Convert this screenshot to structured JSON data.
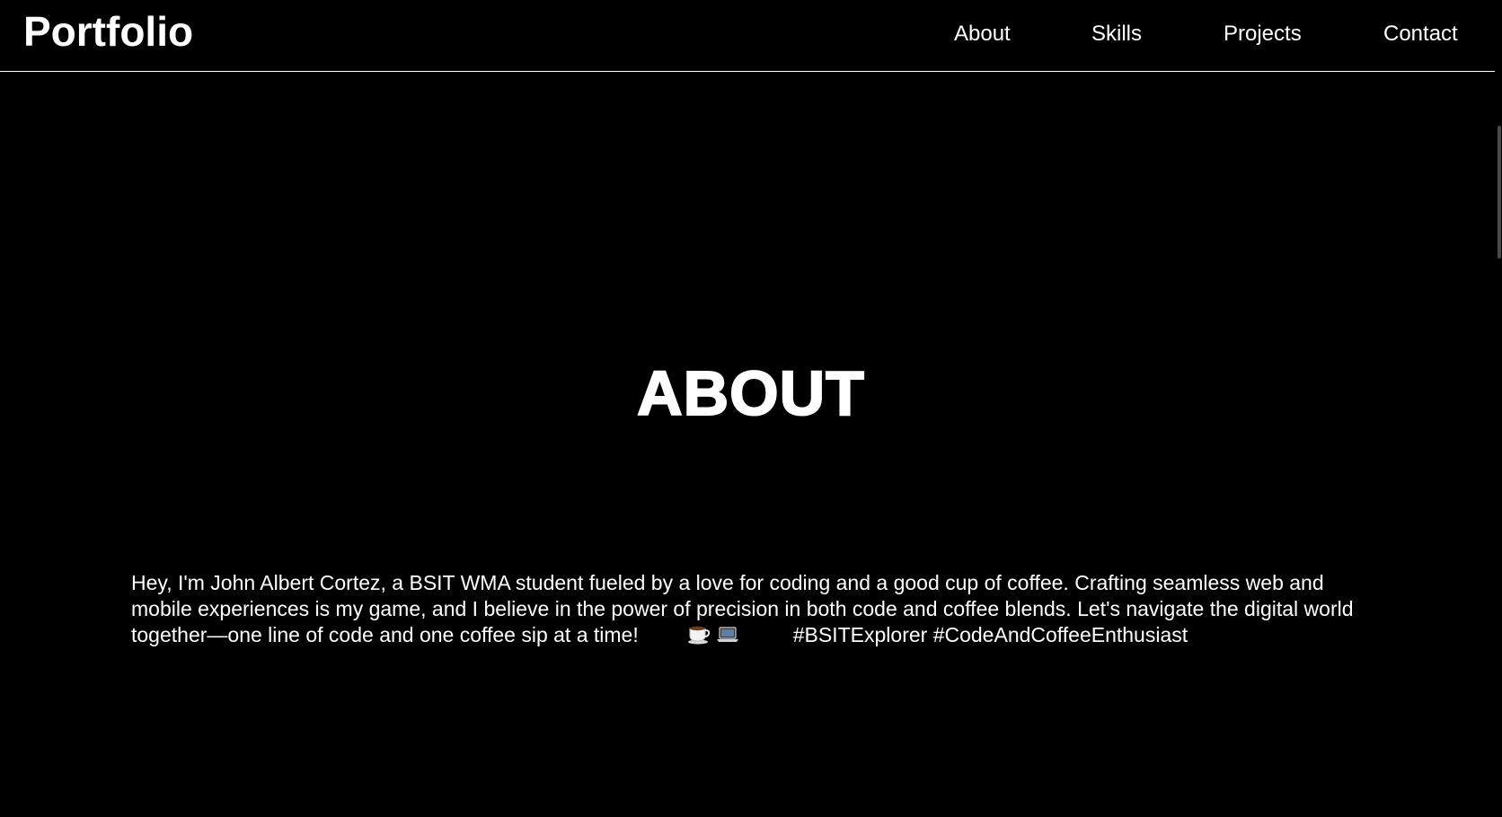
{
  "header": {
    "brand": "Portfolio",
    "nav": {
      "about": "About",
      "skills": "Skills",
      "projects": "Projects",
      "contact": "Contact"
    }
  },
  "about": {
    "title": "ABOUT",
    "body_main": "Hey, I'm John Albert Cortez, a BSIT WMA student fueled by a love for coding and a good cup of coffee. Crafting seamless web and mobile experiences is my game, and I believe in the power of precision in both code and coffee blends. Let's navigate the digital world together—one line of code and one coffee sip at a time!",
    "hashtags": "#BSITExplorer #CodeAndCoffeeEnthusiast",
    "emoji_icons": [
      "coffee-cup-icon",
      "laptop-icon"
    ]
  },
  "colors": {
    "background": "#000000",
    "text": "#ffffff",
    "divider": "#ffffff"
  }
}
